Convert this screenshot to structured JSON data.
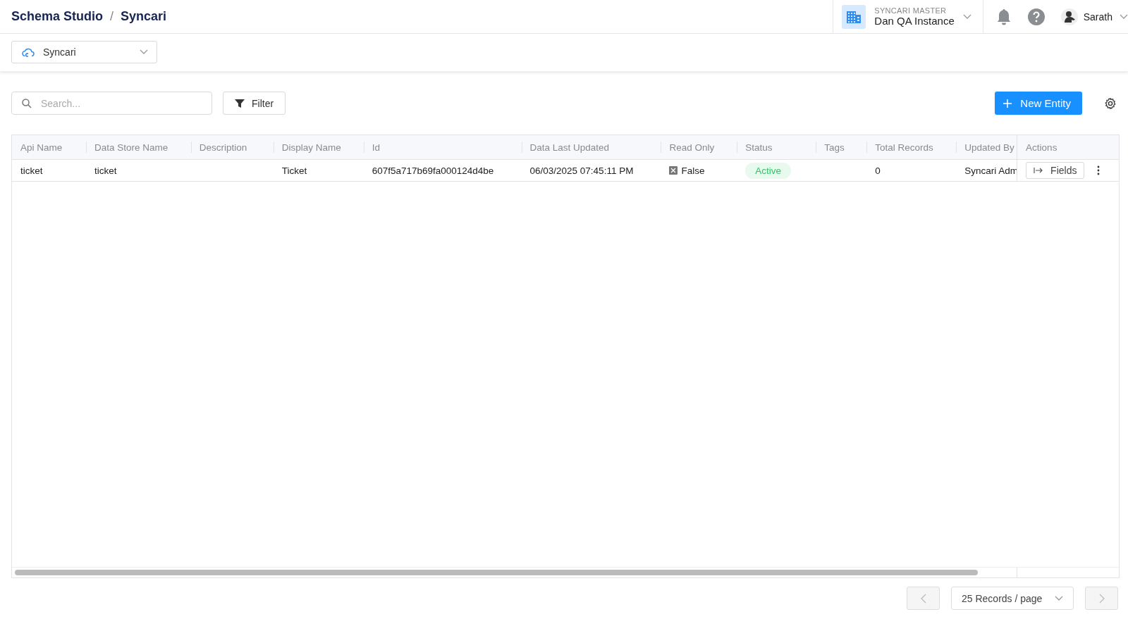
{
  "breadcrumb": [
    "Schema Studio",
    "Syncari"
  ],
  "breadcrumb_separator": "/",
  "instance": {
    "label": "SYNCARI MASTER",
    "name": "Dan QA Instance"
  },
  "user": {
    "name": "Sarath"
  },
  "source_select": {
    "value": "Syncari"
  },
  "search": {
    "placeholder": "Search..."
  },
  "filter_button": "Filter",
  "new_button": "New Entity",
  "table": {
    "columns": [
      "Api Name",
      "Data Store Name",
      "Description",
      "Display Name",
      "Id",
      "Data Last Updated",
      "Read Only",
      "Status",
      "Tags",
      "Total Records",
      "Updated By",
      "Actions"
    ],
    "rows": [
      {
        "api_name": "ticket",
        "data_store_name": "ticket",
        "display_name": "Ticket",
        "id": "607f5a717b69fa000124d4be",
        "data_last_updated": "06/03/2025 07:45:11 PM",
        "read_only": "False",
        "status": "Active",
        "total_records": "0",
        "updated_by": "Syncari Adm",
        "action": "Fields"
      }
    ]
  },
  "pagination": {
    "page_size": "25 Records / page",
    "prev_disabled": true,
    "next_disabled": true
  }
}
